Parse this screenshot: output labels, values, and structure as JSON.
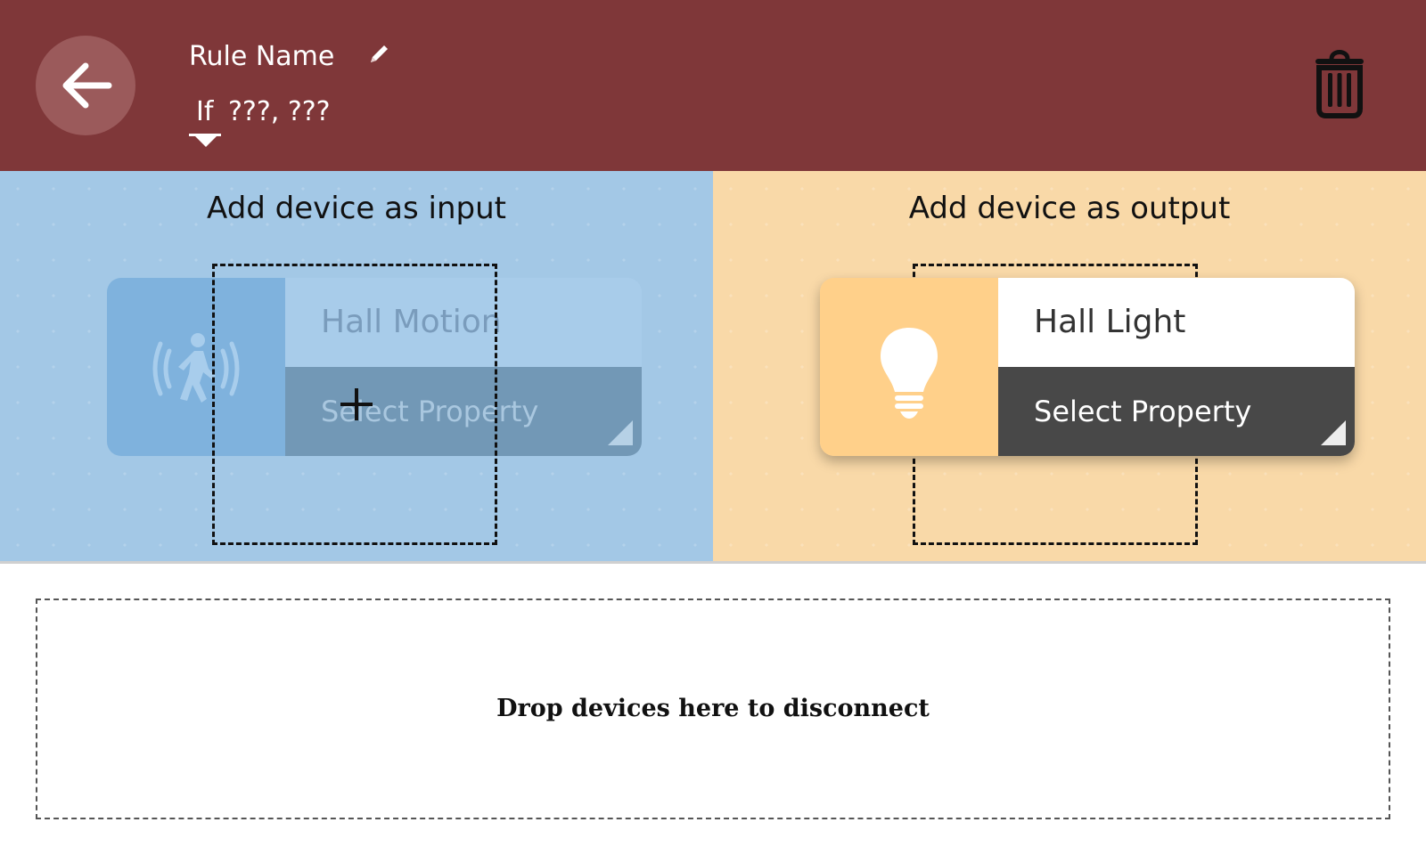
{
  "header": {
    "back_icon": "arrow-left-icon",
    "rule_name": "Rule Name",
    "edit_icon": "pencil-icon",
    "if_label": "If",
    "rule_summary": "???, ???",
    "delete_icon": "trash-icon",
    "background_color": "#7f3739"
  },
  "input_panel": {
    "title": "Add device as input",
    "background_color": "#a3c8e6",
    "device": {
      "name": "Hall Motion",
      "property_placeholder": "Select Property",
      "icon": "motion-sensor-icon",
      "state": "dragging-ghost"
    }
  },
  "output_panel": {
    "title": "Add device as output",
    "background_color": "#f9d9a8",
    "device": {
      "name": "Hall Light",
      "property_placeholder": "Select Property",
      "icon": "light-bulb-icon"
    }
  },
  "disconnect": {
    "label": "Drop devices here to disconnect"
  }
}
